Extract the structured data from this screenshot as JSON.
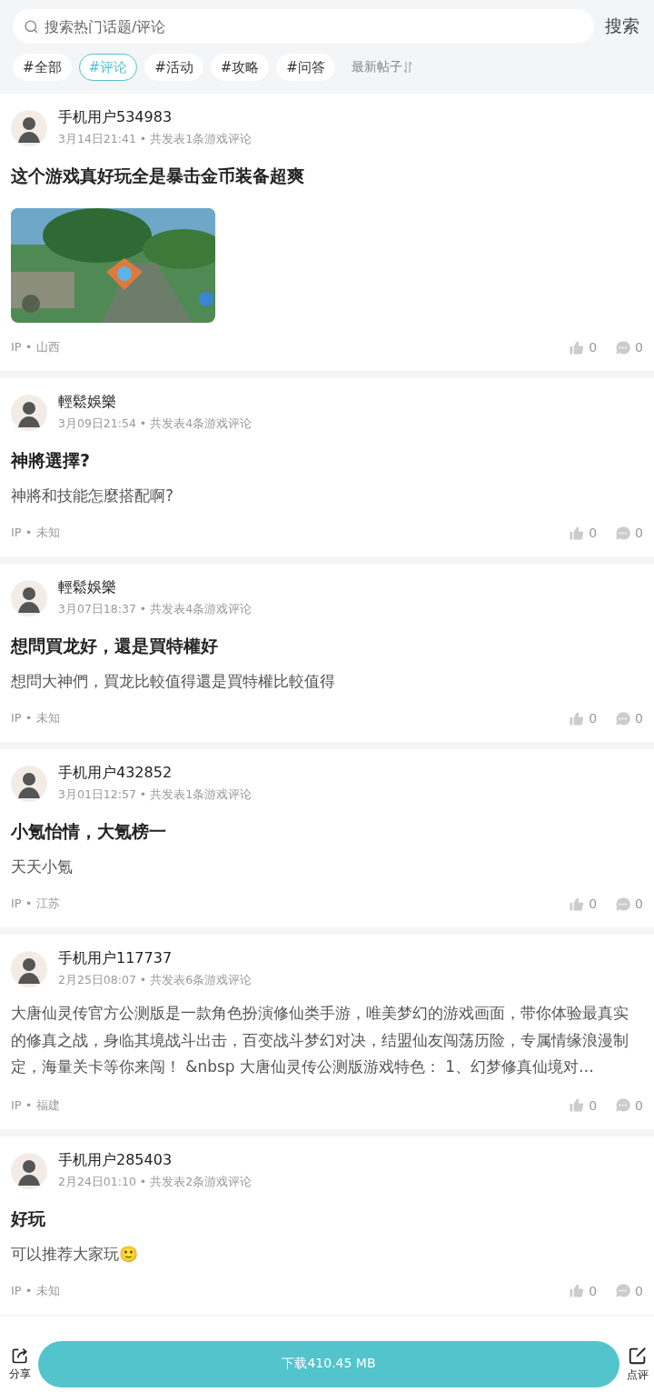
{
  "search": {
    "placeholder": "搜索热门话题/评论",
    "button": "搜索"
  },
  "tabs": [
    {
      "label": "#全部",
      "selected": false
    },
    {
      "label": "#评论",
      "selected": true
    },
    {
      "label": "#活动",
      "selected": false
    },
    {
      "label": "#攻略",
      "selected": false
    },
    {
      "label": "#问答",
      "selected": false
    }
  ],
  "sort": "最新帖子",
  "posts": [
    {
      "user": "手机用户534983",
      "meta": "3月14日21:41 • 共发表1条游戏评论",
      "title": "这个游戏真好玩全是暴击金币装备超爽",
      "ip": "IP • 山西",
      "likes": "0",
      "comments": "0"
    },
    {
      "user": "輕鬆娛樂",
      "meta": "3月09日21:54 • 共发表4条游戏评论",
      "title": "神將選擇?",
      "body": "神將和技能怎麼搭配啊?",
      "ip": "IP • 未知",
      "likes": "0",
      "comments": "0"
    },
    {
      "user": "輕鬆娛樂",
      "meta": "3月07日18:37 • 共发表4条游戏评论",
      "title": "想問買龙好，還是買特權好",
      "body": "想問大神們，買龙比較值得還是買特權比較值得",
      "ip": "IP • 未知",
      "likes": "0",
      "comments": "0"
    },
    {
      "user": "手机用户432852",
      "meta": "3月01日12:57 • 共发表1条游戏评论",
      "title": "小氪怡情，大氪榜一",
      "body": "天天小氪",
      "ip": "IP • 江苏",
      "likes": "0",
      "comments": "0"
    },
    {
      "user": "手机用户117737",
      "meta": "2月25日08:07 • 共发表6条游戏评论",
      "body": "大唐仙灵传官方公测版是一款角色扮演修仙类手游，唯美梦幻的游戏画面，带你体验最真实的修真之战，身临其境战斗出击，百变战斗梦幻对决，结盟仙友闯荡历险，专属情缘浪漫制定，海量关卡等你来闯！ &nbsp 大唐仙灵传公测版游戏特色： 1、幻梦修真仙境对…",
      "ip": "IP • 福建",
      "likes": "0",
      "comments": "0"
    },
    {
      "user": "手机用户285403",
      "meta": "2月24日01:10 • 共发表2条游戏评论",
      "title": "好玩",
      "body": "可以推荐大家玩🙂",
      "ip": "IP • 未知",
      "likes": "0",
      "comments": "0"
    }
  ],
  "bottom_bar": {
    "share": "分享",
    "download": "下载410.45 MB",
    "review": "点评"
  }
}
